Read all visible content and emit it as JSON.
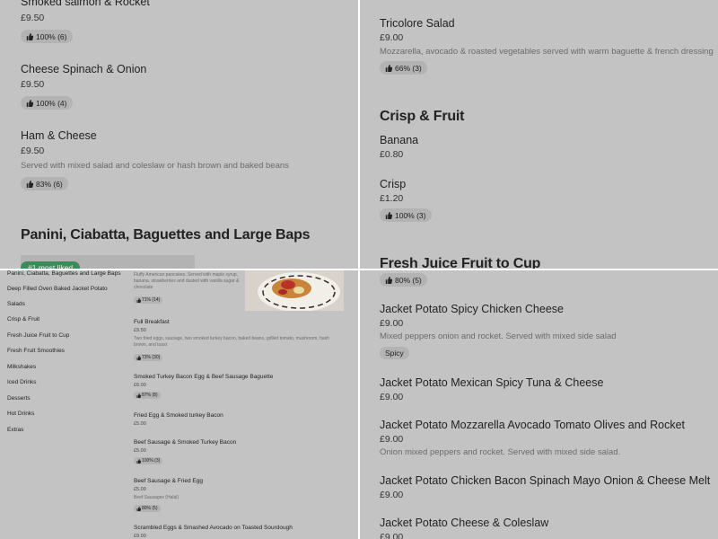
{
  "colors": {
    "overlay": "#c3c3c3",
    "badge": "#b3b3b3",
    "accent_green": "#3e8b5a"
  },
  "top_left": {
    "items": [
      {
        "name": "Smoked salmon & Rocket",
        "price": "£9.50",
        "rating": "100% (6)"
      },
      {
        "name": "Cheese Spinach & Onion",
        "price": "£9.50",
        "rating": "100% (4)"
      },
      {
        "name": "Ham & Cheese",
        "price": "£9.50",
        "desc": "Served with mixed salad and coleslaw or hash brown and baked beans",
        "rating": "83% (6)"
      }
    ],
    "section_title": "Panini, Ciabatta, Baguettes and Large Baps",
    "most_liked": "#1 most liked"
  },
  "top_right": {
    "items": [
      {
        "name": "Tricolore Salad",
        "price": "£9.00",
        "desc": "Mozzarella, avocado & roasted vegetables served with warm baguette & french dressing",
        "rating": "66% (3)"
      }
    ],
    "crisp_section_title": "Crisp & Fruit",
    "crisp_items": [
      {
        "name": "Banana",
        "price": "£0.80"
      },
      {
        "name": "Crisp",
        "price": "£1.20",
        "rating": "100% (3)"
      }
    ],
    "juice_section_title": "Fresh Juice Fruit to Cup"
  },
  "bottom_left": {
    "sidebar": [
      "Panini, Ciabatta, Baguettes and Large Baps",
      "Deep Filled Oven Baked Jacket Potato",
      "Salads",
      "Crisp & Fruit",
      "Fresh Juice Fruit to Cup",
      "Fresh Fruit Smoothies",
      "Milkshakes",
      "Iced Drinks",
      "Desserts",
      "Hot Drinks",
      "Extras"
    ],
    "pancake_desc": "Fluffy American pancakes. Served with maple syrup, banana, strawberries and dusted with vanilla sugar & chocolate",
    "pancake_rating": "71% (14)",
    "items": [
      {
        "name": "Full Breakfast",
        "price": "£9.50",
        "desc": "Two fried eggs, sausage, two smoked turkey bacon, baked beans, grilled tomato, mushroom, hash brown, and toast",
        "rating": "73% (30)"
      },
      {
        "name": "Smoked Turkey Bacon Egg & Beef Sausage Baguette",
        "price": "£6.00",
        "rating": "87% (8)"
      },
      {
        "name": "Fried Egg & Smoked turkey Bacon",
        "price": "£5.00"
      },
      {
        "name": "Beef Sausage & Smoked Turkey Bacon",
        "price": "£5.00",
        "rating": "100% (3)"
      },
      {
        "name": "Beef Sausage & Fried Egg",
        "price": "£5.00",
        "desc": "Beef Sausages (Halal)",
        "rating": "80% (5)"
      },
      {
        "name": "Scrambled Eggs & Smashed Avocado on Toasted Sourdough",
        "price": "£9.00"
      }
    ]
  },
  "bottom_right": {
    "top_rating": "80% (5)",
    "items": [
      {
        "name": "Jacket Potato Spicy Chicken Cheese",
        "price": "£9.00",
        "desc": "Mixed peppers onion and rocket. Served with mixed side salad",
        "tag": "Spicy"
      },
      {
        "name": "Jacket Potato Mexican Spicy Tuna & Cheese",
        "price": "£9.00"
      },
      {
        "name": "Jacket Potato Mozzarella Avocado Tomato Olives and Rocket",
        "price": "£9.00",
        "desc": "Onion mixed peppers and rocket. Served with mixed side salad."
      },
      {
        "name": "Jacket Potato Chicken Bacon Spinach Mayo Onion & Cheese Melt",
        "price": "£9.00"
      },
      {
        "name": "Jacket Potato Cheese & Coleslaw",
        "price": "£9.00"
      }
    ]
  }
}
